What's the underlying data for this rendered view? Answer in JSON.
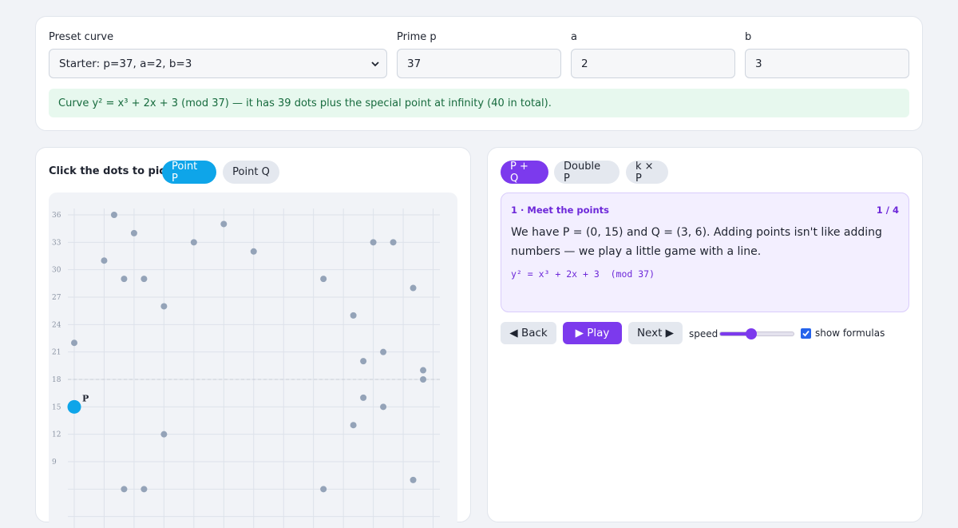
{
  "controls": {
    "preset_label": "Preset curve",
    "preset_value": "Starter: p=37, a=2, b=3",
    "prime_label": "Prime p",
    "prime_value": "37",
    "a_label": "a",
    "a_value": "2",
    "b_label": "b",
    "b_value": "3"
  },
  "info": "Curve y² = x³ + 2x + 3 (mod 37) — it has 39 dots plus the special point at infinity (40 in total).",
  "picker": {
    "label": "Click the dots to pick:",
    "point_p": "Point P",
    "point_q": "Point Q"
  },
  "ops": {
    "add": "P + Q",
    "double": "Double P",
    "mult": "k × P"
  },
  "step": {
    "title": "1 · Meet the points",
    "counter": "1 / 4",
    "text": "We have P = (0, 15) and Q = (3, 6). Adding points isn't like adding numbers — we play a little game with a line.",
    "formula": "y² = x³ + 2x + 3  (mod 37)"
  },
  "nav": {
    "back": "◀ Back",
    "play": "▶ Play",
    "next": "Next ▶"
  },
  "speed": {
    "label": "speed",
    "level": 0.42
  },
  "show_formulas": {
    "label": "show formulas",
    "checked": true
  },
  "colors": {
    "accent_purple": "#7c3aed",
    "accent_blue": "#0ea5e9",
    "dot": "#94a3b8",
    "info_bg": "#e7f8ee"
  },
  "chart_data": {
    "type": "scatter",
    "y_tick_labels": [
      "36",
      "33",
      "30",
      "27",
      "24",
      "21",
      "18",
      "15",
      "12",
      "9"
    ],
    "y_ticks": [
      36,
      33,
      30,
      27,
      24,
      21,
      18,
      15,
      12,
      9
    ],
    "xlim": [
      0,
      37
    ],
    "ylim": [
      0,
      36
    ],
    "grid": true,
    "reference_y": 18,
    "selected_label": "P",
    "selected_point": {
      "x": 0,
      "y": 15
    },
    "points": [
      [
        0,
        22
      ],
      [
        3,
        31
      ],
      [
        4,
        36
      ],
      [
        5,
        29
      ],
      [
        6,
        34
      ],
      [
        7,
        29
      ],
      [
        9,
        26
      ],
      [
        9,
        12
      ],
      [
        12,
        33
      ],
      [
        15,
        35
      ],
      [
        18,
        32
      ],
      [
        25,
        29
      ],
      [
        28,
        25
      ],
      [
        28,
        13
      ],
      [
        29,
        20
      ],
      [
        29,
        16
      ],
      [
        30,
        33
      ],
      [
        31,
        21
      ],
      [
        31,
        15
      ],
      [
        32,
        33
      ],
      [
        34,
        28
      ],
      [
        35,
        19
      ],
      [
        35,
        18
      ],
      [
        5,
        6
      ],
      [
        7,
        6
      ],
      [
        25,
        6
      ],
      [
        34,
        7
      ]
    ]
  }
}
